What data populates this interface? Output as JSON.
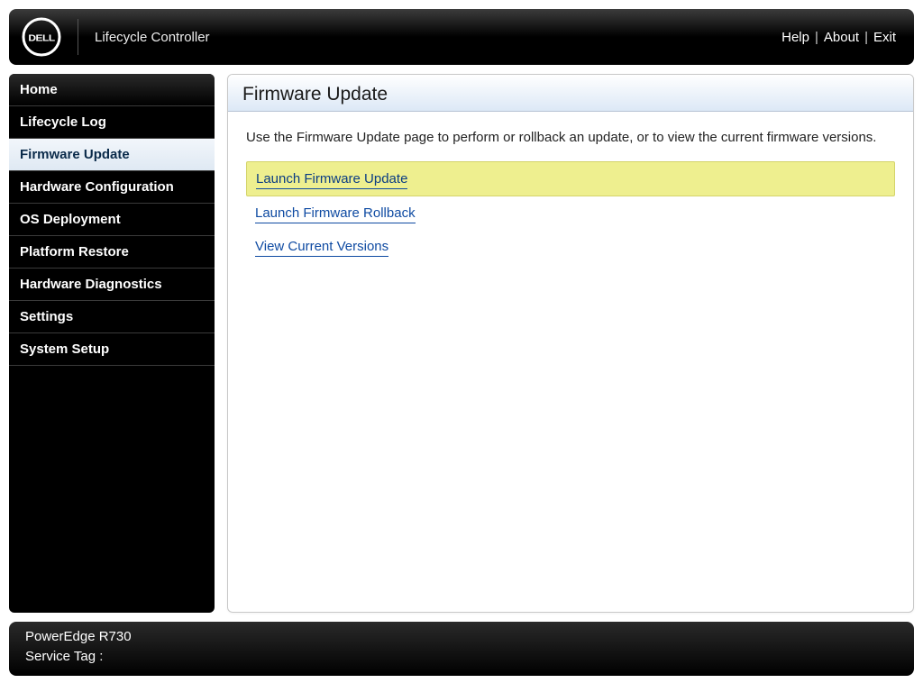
{
  "header": {
    "brand_title": "Lifecycle Controller",
    "help_label": "Help",
    "about_label": "About",
    "exit_label": "Exit"
  },
  "sidebar": {
    "items": [
      {
        "label": "Home",
        "selected": false
      },
      {
        "label": "Lifecycle Log",
        "selected": false
      },
      {
        "label": "Firmware Update",
        "selected": true
      },
      {
        "label": "Hardware Configuration",
        "selected": false
      },
      {
        "label": "OS Deployment",
        "selected": false
      },
      {
        "label": "Platform Restore",
        "selected": false
      },
      {
        "label": "Hardware Diagnostics",
        "selected": false
      },
      {
        "label": "Settings",
        "selected": false
      },
      {
        "label": "System Setup",
        "selected": false
      }
    ]
  },
  "content": {
    "title": "Firmware Update",
    "description": "Use the Firmware Update page to perform or rollback an update, or to view the current firmware versions.",
    "links": [
      {
        "label": "Launch Firmware Update",
        "selected": true
      },
      {
        "label": "Launch Firmware Rollback",
        "selected": false
      },
      {
        "label": "View Current Versions",
        "selected": false
      }
    ]
  },
  "footer": {
    "model": "PowerEdge R730",
    "service_tag_label": "Service Tag :",
    "service_tag_value": ""
  }
}
